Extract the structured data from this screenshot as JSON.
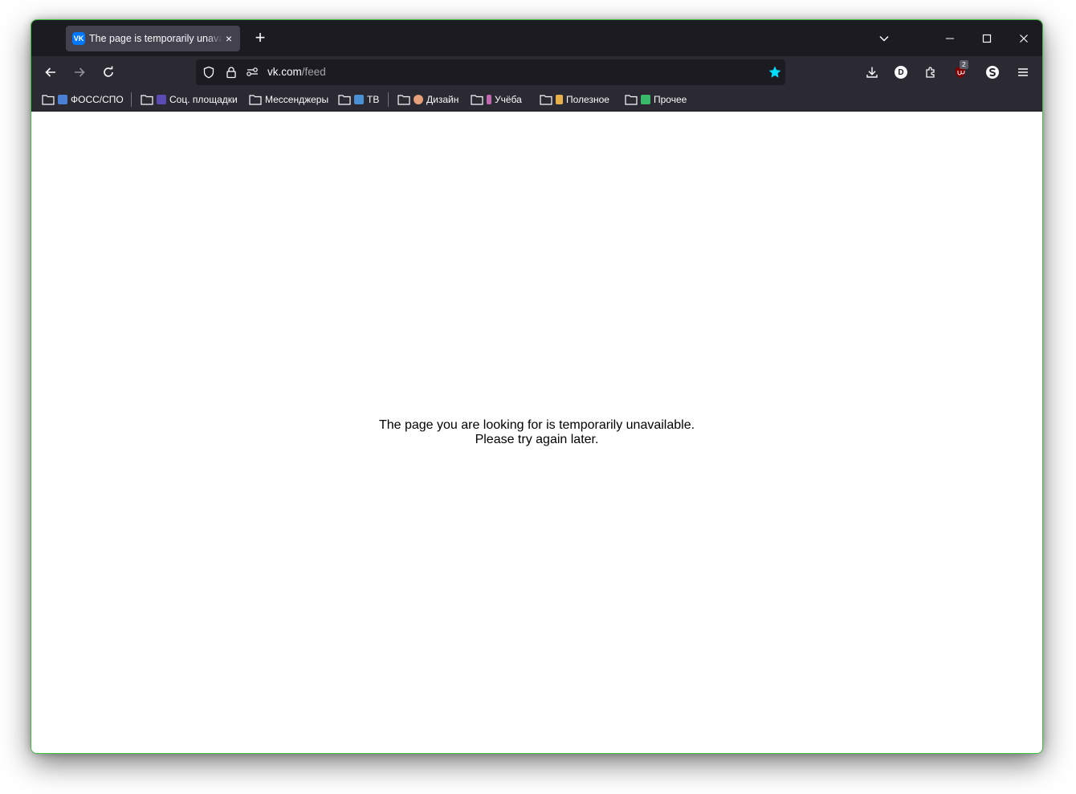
{
  "tab": {
    "favicon_text": "VK",
    "title": "The page is temporarily unavailable",
    "close_glyph": "×"
  },
  "newtab_glyph": "+",
  "address": {
    "host": "vk.com",
    "path": "/feed"
  },
  "bookmarks": [
    {
      "label": "ФОСС/СПО",
      "emoji": "💻",
      "emoji_bg": "#4a7fd4"
    },
    {
      "label": "Соц. площадки",
      "emoji": "👥",
      "emoji_bg": "#5b4bb5"
    },
    {
      "label": "Мессенджеры",
      "emoji": "",
      "emoji_bg": ""
    },
    {
      "label": "ТВ",
      "emoji": "📺",
      "emoji_bg": "#4a8fd4"
    },
    {
      "label": "Дизайн",
      "emoji": "🎨",
      "emoji_bg": "#e8a07a"
    },
    {
      "label": "Учёба",
      "emoji": "🤸",
      "emoji_bg": "#c06ab0"
    },
    {
      "label": "Полезное",
      "emoji": "☝",
      "emoji_bg": "#e8b04a"
    },
    {
      "label": "Прочее",
      "emoji": "✳",
      "emoji_bg": "#3bb96a"
    }
  ],
  "extensions": {
    "d_label": "D",
    "ublock_count": "2"
  },
  "page": {
    "line1": "The page you are looking for is temporarily unavailable.",
    "line2": "Please try again later."
  },
  "colors": {
    "accent_star": "#00ddff",
    "window_border": "#3fbf3f",
    "toolbar": "#2b2a33",
    "titlebar": "#1c1b22"
  }
}
